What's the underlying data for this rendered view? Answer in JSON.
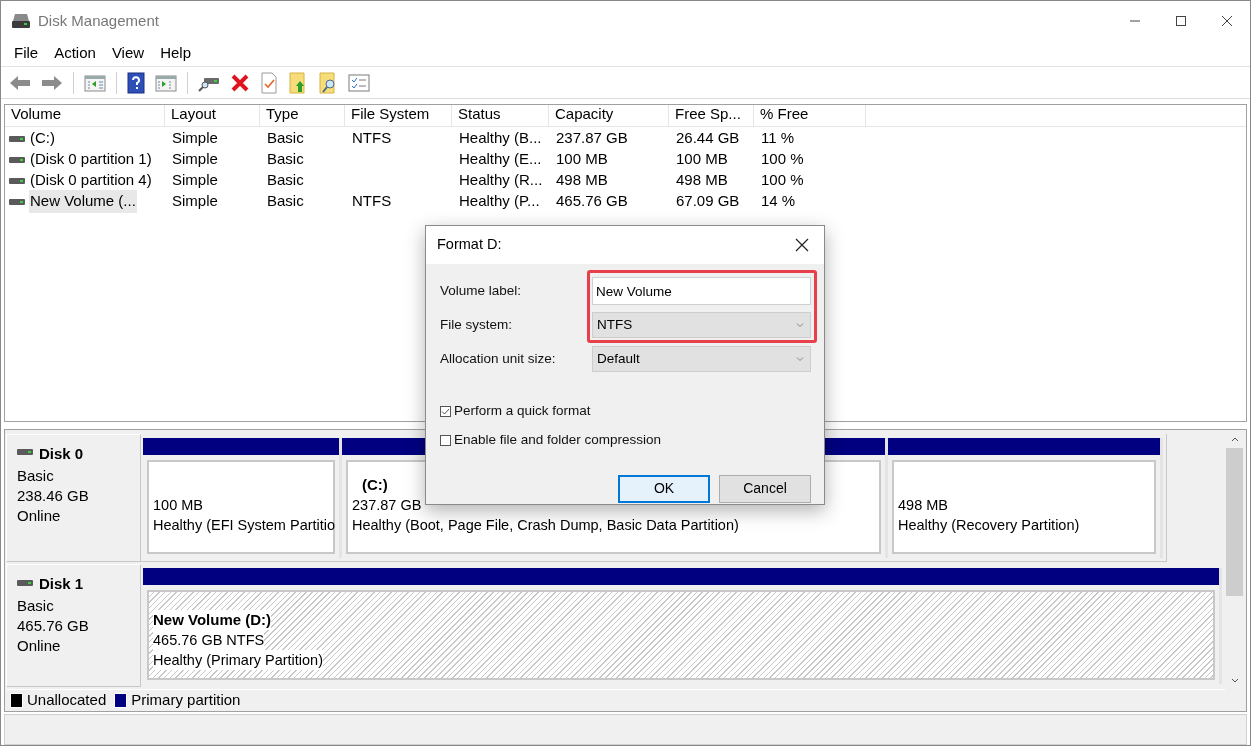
{
  "window": {
    "title": "Disk Management"
  },
  "menu": [
    "File",
    "Action",
    "View",
    "Help"
  ],
  "volumes": {
    "columns": [
      "Volume",
      "Layout",
      "Type",
      "File System",
      "Status",
      "Capacity",
      "Free Sp...",
      "% Free"
    ],
    "rows": [
      {
        "cells": [
          "(C:)",
          "Simple",
          "Basic",
          "NTFS",
          "Healthy (B...",
          "237.87 GB",
          "26.44 GB",
          "11 %"
        ],
        "selected": false
      },
      {
        "cells": [
          "(Disk 0 partition 1)",
          "Simple",
          "Basic",
          "",
          "Healthy (E...",
          "100 MB",
          "100 MB",
          "100 %"
        ],
        "selected": false
      },
      {
        "cells": [
          "(Disk 0 partition 4)",
          "Simple",
          "Basic",
          "",
          "Healthy (R...",
          "498 MB",
          "498 MB",
          "100 %"
        ],
        "selected": false
      },
      {
        "cells": [
          "New Volume (...",
          "Simple",
          "Basic",
          "NTFS",
          "Healthy (P...",
          "465.76 GB",
          "67.09 GB",
          "14 %"
        ],
        "selected": true
      }
    ]
  },
  "disks": [
    {
      "name": "Disk 0",
      "type": "Basic",
      "size": "238.46 GB",
      "state": "Online",
      "partitions": [
        {
          "size": "100 MB",
          "status": "Healthy (EFI System Partitio",
          "selected": false
        },
        {
          "name": "(C:)",
          "size": "237.87 GB",
          "status": "Healthy (Boot, Page File, Crash Dump, Basic Data Partition)",
          "selected": false
        },
        {
          "size": "498 MB",
          "status": "Healthy (Recovery Partition)",
          "selected": false
        }
      ]
    },
    {
      "name": "Disk 1",
      "type": "Basic",
      "size": "465.76 GB",
      "state": "Online",
      "partitions": [
        {
          "name": "New Volume  (D:)",
          "size": "465.76 GB NTFS",
          "status": "Healthy (Primary Partition)",
          "selected": true
        }
      ]
    }
  ],
  "legend": [
    {
      "label": "Unallocated",
      "color": "#000000"
    },
    {
      "label": "Primary partition",
      "color": "#000080"
    }
  ],
  "dialog": {
    "title": "Format D:",
    "fields": [
      {
        "label": "Volume label:",
        "kind": "text",
        "value": "New Volume",
        "highlighted": true
      },
      {
        "label": "File system:",
        "kind": "select",
        "value": "NTFS",
        "highlighted": true
      },
      {
        "label": "Allocation unit size:",
        "kind": "select",
        "value": "Default",
        "highlighted": false
      }
    ],
    "options": [
      {
        "label": "Perform a quick format",
        "checked": true
      },
      {
        "label": "Enable file and folder compression",
        "checked": false
      }
    ],
    "buttons": [
      {
        "label": "OK",
        "default": true
      },
      {
        "label": "Cancel",
        "default": false
      }
    ]
  }
}
